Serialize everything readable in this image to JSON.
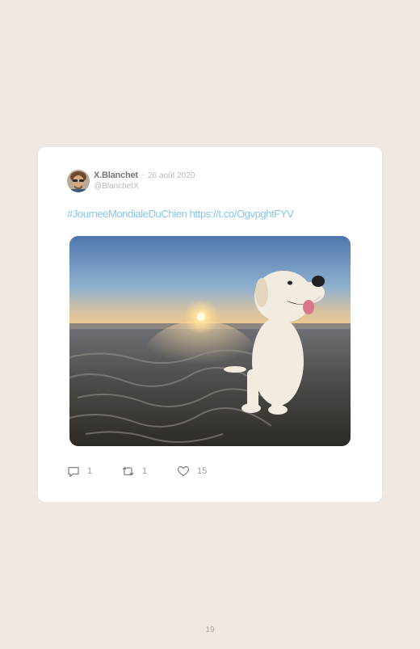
{
  "tweet": {
    "author_name": "X.Blanchet",
    "separator": "·",
    "date": "26 août 2020",
    "handle": "@BlanchetX",
    "hashtag": "#JourneeMondialeDuChien",
    "link": "https://t.co/OgvpghtFYV",
    "photo_icon": "photo-dog-on-beach-at-sunset"
  },
  "actions": {
    "reply_count": "1",
    "retweet_count": "1",
    "like_count": "15"
  },
  "page": {
    "number": "19"
  },
  "colors": {
    "background": "#efe7e2",
    "card": "#ffffff",
    "link": "#87c4e8",
    "muted": "#bdb8b6"
  }
}
